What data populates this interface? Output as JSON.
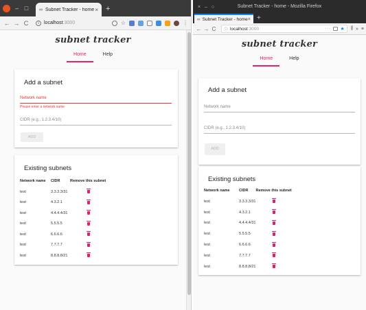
{
  "chrome": {
    "tab": {
      "title": "Subnet Tracker - home",
      "close": "×"
    },
    "new_tab": "+",
    "window_buttons": {
      "close": "",
      "min": "–",
      "max": "□"
    },
    "nav": {
      "back": "←",
      "forward": "→",
      "reload": "C"
    },
    "address": {
      "host": "localhost",
      "port": ":3000"
    }
  },
  "firefox": {
    "window_title": "Subnet Tracker - home - Mozilla Firefox",
    "window_buttons": {
      "close": "×",
      "min": "–",
      "max": "○"
    },
    "tab": {
      "title": "Subnet Tracker - home",
      "close": "×"
    },
    "new_tab": "+",
    "nav": {
      "back": "←",
      "forward": "→",
      "reload": "C"
    },
    "address": {
      "host": "localhost",
      "port": ":3000",
      "more": "···",
      "star": "★"
    },
    "toolbar_right": {
      "library": "⫼",
      "overflow": "»",
      "menu": "≡"
    }
  },
  "app": {
    "logo": "subnet tracker",
    "nav": {
      "home": "Home",
      "help": "Help"
    },
    "add_card": {
      "title": "Add a subnet",
      "network_name_label": "Network name",
      "network_name_error": "Please enter a network name",
      "cidr_label": "CIDR (e.g., 1.2.3.4/10)",
      "add_button": "ADD"
    },
    "list_card": {
      "title": "Existing subnets",
      "headers": {
        "name": "Network name",
        "cidr": "CIDR",
        "remove": "Remove this subnet"
      },
      "rows": [
        {
          "name": "test",
          "cidr": "3.3.3.3/31"
        },
        {
          "name": "test",
          "cidr": "4.3.2.1"
        },
        {
          "name": "test",
          "cidr": "4.4.4.4/31"
        },
        {
          "name": "test",
          "cidr": "5.5.5.5"
        },
        {
          "name": "test",
          "cidr": "6.6.6.6"
        },
        {
          "name": "test",
          "cidr": "7.7.7.7"
        },
        {
          "name": "test",
          "cidr": "8.8.8.8/21"
        }
      ]
    }
  },
  "colors": {
    "accent": "#e91e63",
    "error": "#e53935",
    "chrome_titlebar": "#3a3a3a",
    "firefox_titlebar": "#2b2b2b"
  }
}
